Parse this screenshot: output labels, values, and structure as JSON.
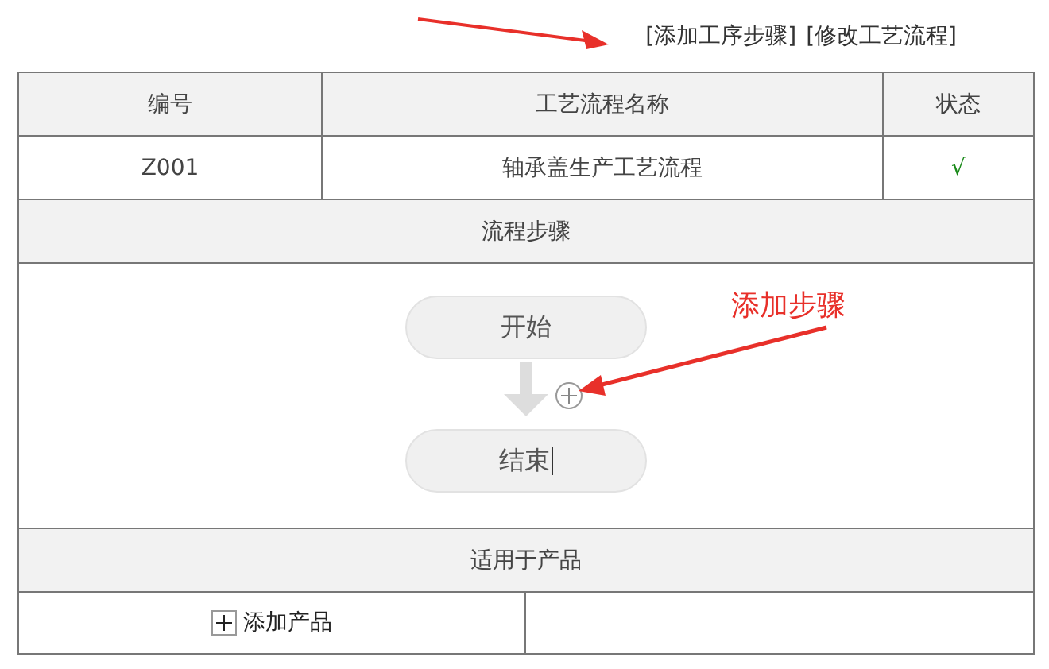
{
  "toolbar": {
    "links": [
      "[添加工序步骤]",
      "[修改工艺流程]"
    ]
  },
  "table": {
    "columns": [
      "编号",
      "工艺流程名称",
      "状态"
    ],
    "rows": [
      {
        "code": "Z001",
        "name": "轴承盖生产工艺流程",
        "status": "√"
      }
    ]
  },
  "steps_section": {
    "title": "流程步骤",
    "steps": [
      {
        "label": "开始",
        "editing": false
      },
      {
        "label": "结束",
        "editing": true
      }
    ]
  },
  "products_section": {
    "title": "适用于产品",
    "add_label": "添加产品"
  },
  "annotations": [
    {
      "kind": "arrow"
    },
    {
      "kind": "labeled_arrow",
      "label": "添加步骤"
    }
  ]
}
